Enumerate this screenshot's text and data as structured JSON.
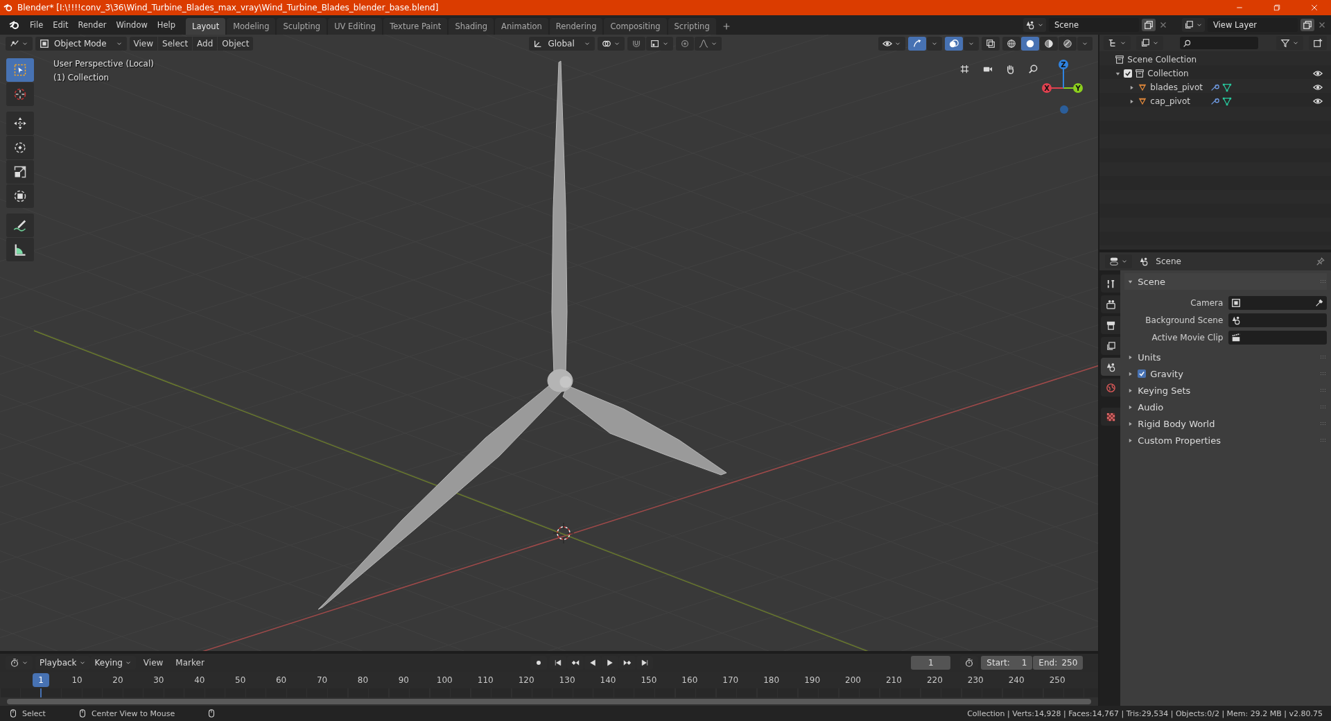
{
  "title_bar": {
    "title": "Blender* [I:\\!!!!conv_3\\36\\Wind_Turbine_Blades_max_vray\\Wind_Turbine_Blades_blender_base.blend]"
  },
  "menu": [
    "File",
    "Edit",
    "Render",
    "Window",
    "Help"
  ],
  "workspaces": [
    {
      "label": "Layout",
      "selected": true
    },
    {
      "label": "Modeling",
      "selected": false
    },
    {
      "label": "Sculpting",
      "selected": false
    },
    {
      "label": "UV Editing",
      "selected": false
    },
    {
      "label": "Texture Paint",
      "selected": false
    },
    {
      "label": "Shading",
      "selected": false
    },
    {
      "label": "Animation",
      "selected": false
    },
    {
      "label": "Rendering",
      "selected": false
    },
    {
      "label": "Compositing",
      "selected": false
    },
    {
      "label": "Scripting",
      "selected": false
    }
  ],
  "scene_selector": {
    "value": "Scene"
  },
  "view_layer_selector": {
    "value": "View Layer"
  },
  "viewport": {
    "mode": "Object Mode",
    "menus": [
      "View",
      "Select",
      "Add",
      "Object"
    ],
    "orientation": "Global",
    "shading": [
      {
        "kind": "wireframe",
        "selected": false
      },
      {
        "kind": "solid",
        "selected": true
      },
      {
        "kind": "material",
        "selected": false
      },
      {
        "kind": "rendered",
        "selected": false
      }
    ],
    "overlay_text": [
      "User Perspective (Local)",
      "(1) Collection"
    ],
    "axes": [
      "X",
      "Y",
      "Z"
    ],
    "tool_groups": [
      {
        "tools": [
          {
            "kind": "select",
            "selected": true
          },
          {
            "kind": "cursor",
            "selected": false
          }
        ]
      },
      {
        "tools": [
          {
            "kind": "move",
            "selected": false
          },
          {
            "kind": "rotate",
            "selected": false
          },
          {
            "kind": "scale",
            "selected": false
          },
          {
            "kind": "transform",
            "selected": false
          }
        ]
      },
      {
        "tools": [
          {
            "kind": "annotate",
            "selected": false
          },
          {
            "kind": "measure",
            "selected": false
          }
        ]
      }
    ]
  },
  "outliner": {
    "root": "Scene Collection",
    "items": [
      {
        "label": "Collection",
        "checked": true,
        "expanded": true,
        "children": [
          {
            "label": "blades_pivot",
            "expanded": false
          },
          {
            "label": "cap_pivot",
            "expanded": false
          }
        ]
      }
    ]
  },
  "properties": {
    "context": "Scene",
    "tabs": [
      {
        "kind": "tool",
        "selected": false
      },
      {
        "kind": "render",
        "selected": false
      },
      {
        "kind": "output",
        "selected": false
      },
      {
        "kind": "view_layer",
        "selected": false
      },
      {
        "kind": "scene",
        "selected": true
      },
      {
        "kind": "world",
        "selected": false
      },
      {
        "kind": "texture",
        "selected": false
      }
    ],
    "panels": [
      {
        "label": "Scene",
        "expanded": true,
        "fields": [
          {
            "label": "Camera",
            "kind": "camera"
          },
          {
            "label": "Background Scene",
            "kind": "scene"
          },
          {
            "label": "Active Movie Clip",
            "kind": "clip"
          }
        ]
      },
      {
        "label": "Units",
        "expanded": false
      },
      {
        "label": "Gravity",
        "expanded": false,
        "checked": true
      },
      {
        "label": "Keying Sets",
        "expanded": false
      },
      {
        "label": "Audio",
        "expanded": false
      },
      {
        "label": "Rigid Body World",
        "expanded": false
      },
      {
        "label": "Custom Properties",
        "expanded": false
      }
    ]
  },
  "timeline": {
    "menus": [
      "Playback",
      "Keying",
      "View",
      "Marker"
    ],
    "frame": "1",
    "start_label": "Start:",
    "start": "1",
    "end_label": "End:",
    "end": "250",
    "ruler_current": "1",
    "ruler_labels": [
      "10",
      "20",
      "30",
      "40",
      "50",
      "60",
      "70",
      "80",
      "90",
      "100",
      "110",
      "120",
      "130",
      "140",
      "150",
      "160",
      "170",
      "180",
      "190",
      "200",
      "210",
      "220",
      "230",
      "240",
      "250"
    ]
  },
  "status_bar": {
    "hints": [
      "Select",
      "Center View to Mouse"
    ],
    "stats": "Collection | Verts:14,928 | Faces:14,767 | Tris:29,534 | Objects:0/2 | Mem: 29.2 MB | v2.80.75"
  }
}
